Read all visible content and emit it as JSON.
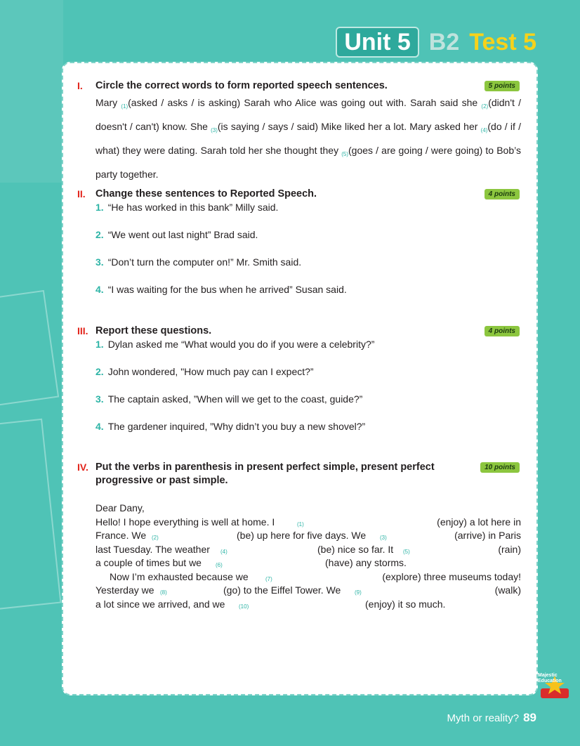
{
  "header": {
    "unit": "Unit 5",
    "level": "B2",
    "test": "Test 5"
  },
  "footer": {
    "title": "Myth or reality?",
    "page": "89"
  },
  "logo": {
    "text": "Majestic Education"
  },
  "s1": {
    "roman": "I.",
    "heading": "Circle the correct words to form reported speech sentences.",
    "points": "5 points",
    "t1": "Mary ",
    "n1": "(1)",
    "t2": "(asked / asks / is asking) Sarah who Alice was going out with. Sarah said she ",
    "n2": "(2)",
    "t3": "(didn't / doesn't / can't) know. She ",
    "n3": "(3)",
    "t4": "(is saying / says / said) Mike liked her a lot. Mary asked her ",
    "n4": "(4)",
    "t5": "(do / if / what) they were dating. Sarah told her she thought they ",
    "n5": "(5)",
    "t6": "(goes / are going / were going) to Bob’s party together."
  },
  "s2": {
    "roman": "II.",
    "heading": "Change these sentences to Reported Speech.",
    "points": "4 points",
    "items": [
      {
        "n": "1.",
        "text": "“He has worked in this bank” Milly said."
      },
      {
        "n": "2.",
        "text": "“We went out last night” Brad said."
      },
      {
        "n": "3.",
        "text": "“Don’t turn the computer on!” Mr. Smith said."
      },
      {
        "n": "4.",
        "text": "“I was waiting for the bus when he arrived” Susan said."
      }
    ]
  },
  "s3": {
    "roman": "III.",
    "heading": "Report these questions.",
    "points": "4 points",
    "items": [
      {
        "n": "1.",
        "text": "Dylan asked me “What would you do if you were a celebrity?”"
      },
      {
        "n": "2.",
        "text": "John wondered, \"How much pay can I expect?”"
      },
      {
        "n": "3.",
        "text": "The captain asked, ”When will we get to the coast, guide?”"
      },
      {
        "n": "4.",
        "text": "The gardener inquired, ”Why didn’t you buy a new shovel?”"
      }
    ]
  },
  "s4": {
    "roman": "IV.",
    "heading1": "Put the verbs in parenthesis in present perfect simple, present perfect",
    "heading2": "progressive or past simple.",
    "points": "10 points",
    "letter": {
      "greeting": "Dear Dany,",
      "r1a": "Hello! I hope everything is well at home. I",
      "r1n": "(1)",
      "r1b": "(enjoy) a lot here in",
      "r2a": "France. We",
      "r2n": "(2)",
      "r2b": "(be) up here for five days. We",
      "r2n2": "(3)",
      "r2c": "(arrive) in Paris",
      "r3a": "last Tuesday. The weather",
      "r3n": "(4)",
      "r3b": "(be) nice so far. It",
      "r3n2": "(5)",
      "r3c": "(rain)",
      "r4a": "a couple of times but we",
      "r4n": "(6)",
      "r4b": "(have) any storms.",
      "r5a": "Now I’m exhausted because we",
      "r5n": "(7)",
      "r5b": "(explore) three museums today!",
      "r6a": "Yesterday we",
      "r6n": "(8)",
      "r6b": "(go) to the Eiffel Tower. We",
      "r6n2": "(9)",
      "r6c": "(walk)",
      "r7a": "a lot since we arrived, and we",
      "r7n": "(10)",
      "r7b": "(enjoy) it so much."
    }
  }
}
